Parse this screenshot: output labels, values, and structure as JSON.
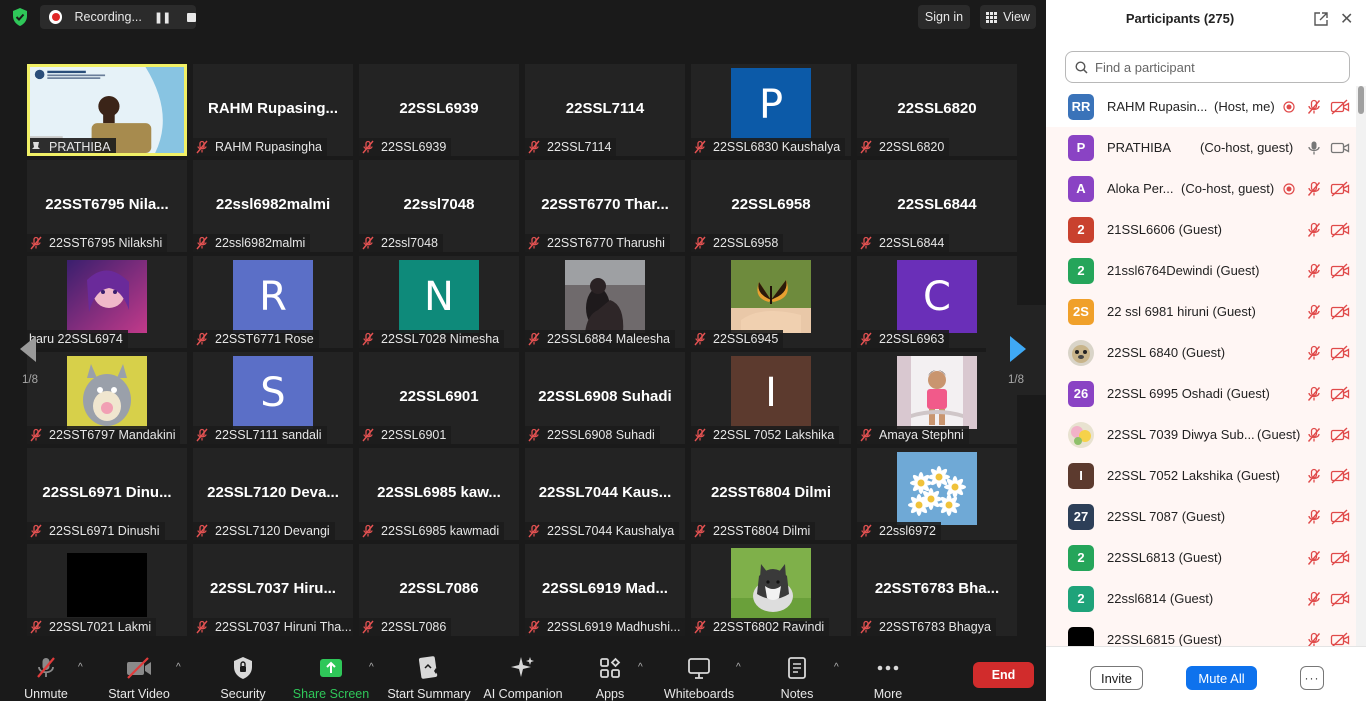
{
  "top_bar": {
    "recording_label": "Recording...",
    "sign_in": "Sign in",
    "view": "View"
  },
  "grid": {
    "page_left": "1/8",
    "page_right": "1/8",
    "tiles": [
      {
        "kind": "speaker",
        "label": "PRATHIBA"
      },
      {
        "kind": "name",
        "name": "RAHM Rupasing...",
        "label": "RAHM Rupasingha"
      },
      {
        "kind": "name",
        "name": "22SSL6939",
        "label": "22SSL6939"
      },
      {
        "kind": "name",
        "name": "22SSL7114",
        "label": "22SSL7114"
      },
      {
        "kind": "letter",
        "letter": "P",
        "color": "#0c5aa8",
        "label": "22SSL6830 Kaushalya"
      },
      {
        "kind": "name",
        "name": "22SSL6820",
        "label": "22SSL6820"
      },
      {
        "kind": "name",
        "name": "22SST6795 Nila...",
        "label": "22SST6795 Nilakshi"
      },
      {
        "kind": "name",
        "name": "22ssl6982malmi",
        "label": "22ssl6982malmi"
      },
      {
        "kind": "name",
        "name": "22ssl7048",
        "label": "22ssl7048"
      },
      {
        "kind": "name",
        "name": "22SST6770 Thar...",
        "label": "22SST6770 Tharushi"
      },
      {
        "kind": "name",
        "name": "22SSL6958",
        "label": "22SSL6958"
      },
      {
        "kind": "name",
        "name": "22SSL6844",
        "label": "22SSL6844"
      },
      {
        "kind": "photo",
        "photo": "anime",
        "label": "haru 22SSL6974",
        "nomic": true
      },
      {
        "kind": "letter",
        "letter": "R",
        "color": "#5b6fc7",
        "label": "22SST6771 Rose"
      },
      {
        "kind": "letter",
        "letter": "N",
        "color": "#0e8a7a",
        "label": "22SSL7028 Nimesha"
      },
      {
        "kind": "photo",
        "photo": "girl",
        "label": "22SSL6884 Maleesha"
      },
      {
        "kind": "photo",
        "photo": "butterfly",
        "label": "22SSL6945"
      },
      {
        "kind": "letter",
        "letter": "C",
        "color": "#6a2fb8",
        "label": "22SSL6963"
      },
      {
        "kind": "photo",
        "photo": "totoro",
        "label": "22SST6797 Mandakini"
      },
      {
        "kind": "letter",
        "letter": "S",
        "color": "#5b6fc7",
        "label": "22SSL7111 sandali"
      },
      {
        "kind": "name",
        "name": "22SSL6901",
        "label": "22SSL6901"
      },
      {
        "kind": "name",
        "name": "22SSL6908 Suhadi",
        "label": "22SSL6908 Suhadi"
      },
      {
        "kind": "letter",
        "letter": "I",
        "color": "#5c3a2e",
        "label": "22SSL 7052 Lakshika"
      },
      {
        "kind": "photo",
        "photo": "child",
        "label": "Amaya Stephni"
      },
      {
        "kind": "name",
        "name": "22SSL6971 Dinu...",
        "label": "22SSL6971 Dinushi"
      },
      {
        "kind": "name",
        "name": "22SSL7120 Deva...",
        "label": "22SSL7120 Devangi"
      },
      {
        "kind": "name",
        "name": "22SSL6985 kaw...",
        "label": "22SSL6985 kawmadi"
      },
      {
        "kind": "name",
        "name": "22SSL7044 Kaus...",
        "label": "22SSL7044 Kaushalya"
      },
      {
        "kind": "name",
        "name": "22SST6804 Dilmi",
        "label": "22SST6804 Dilmi"
      },
      {
        "kind": "photo",
        "photo": "flowers",
        "label": "22ssl6972"
      },
      {
        "kind": "photo",
        "photo": "black",
        "label": "22SSL7021 Lakmi"
      },
      {
        "kind": "name",
        "name": "22SSL7037 Hiru...",
        "label": "22SSL7037 Hiruni Tha..."
      },
      {
        "kind": "name",
        "name": "22SSL7086",
        "label": "22SSL7086"
      },
      {
        "kind": "name",
        "name": "22SSL6919 Mad...",
        "label": "22SSL6919 Madhushi..."
      },
      {
        "kind": "photo",
        "photo": "husky",
        "label": "22SST6802 Ravindi"
      },
      {
        "kind": "name",
        "name": "22SST6783 Bha...",
        "label": "22SST6783 Bhagya"
      }
    ]
  },
  "toolbar": {
    "items": [
      {
        "id": "unmute",
        "label": "Unmute",
        "icon": "mic-off-icon"
      },
      {
        "id": "start-video",
        "label": "Start Video",
        "icon": "video-off-icon"
      },
      {
        "id": "security",
        "label": "Security",
        "icon": "shield-icon"
      },
      {
        "id": "share-screen",
        "label": "Share Screen",
        "icon": "share-screen-icon"
      },
      {
        "id": "start-summary",
        "label": "Start Summary",
        "icon": "summary-icon"
      },
      {
        "id": "ai-companion",
        "label": "AI Companion",
        "icon": "sparkle-icon"
      },
      {
        "id": "apps",
        "label": "Apps",
        "icon": "apps-icon"
      },
      {
        "id": "whiteboards",
        "label": "Whiteboards",
        "icon": "whiteboard-icon"
      },
      {
        "id": "notes",
        "label": "Notes",
        "icon": "notes-icon"
      },
      {
        "id": "more",
        "label": "More",
        "icon": "more-icon"
      }
    ],
    "end": "End"
  },
  "participants": {
    "title": "Participants (275)",
    "search_placeholder": "Find a participant",
    "rows": [
      {
        "avatar": "RR",
        "color": "#3a73b9",
        "name": "RAHM Rupasin...",
        "role": "(Host, me)",
        "rec": true,
        "mic": "off",
        "video": "off"
      },
      {
        "avatar": "P",
        "color": "#8a43c4",
        "name": "PRATHIBA",
        "role": "(Co-host, guest)",
        "rec": false,
        "mic": "on",
        "video": "on"
      },
      {
        "avatar": "A",
        "color": "#8a43c4",
        "name": "Aloka Per...",
        "role": "(Co-host, guest)",
        "rec": true,
        "mic": "off",
        "video": "off"
      },
      {
        "avatar": "2",
        "color": "#c9412e",
        "name": "21SSL6606 (Guest)",
        "role": "",
        "rec": false,
        "mic": "off",
        "video": "off"
      },
      {
        "avatar": "2",
        "color": "#25a55a",
        "name": "21ssl6764Dewindi (Guest)",
        "role": "",
        "rec": false,
        "mic": "off",
        "video": "off"
      },
      {
        "avatar": "2S",
        "color": "#f0a02a",
        "name": "22 ssl 6981 hiruni (Guest)",
        "role": "",
        "rec": false,
        "mic": "off",
        "video": "off"
      },
      {
        "avatar": "img-dog",
        "color": "#d9d4c8",
        "name": "22SSL 6840 (Guest)",
        "role": "",
        "rec": false,
        "mic": "off",
        "video": "off"
      },
      {
        "avatar": "26",
        "color": "#8a43c4",
        "name": "22SSL 6995 Oshadi (Guest)",
        "role": "",
        "rec": false,
        "mic": "off",
        "video": "off"
      },
      {
        "avatar": "img-flower",
        "color": "#e8e2d0",
        "name": "22SSL 7039 Diwya Sub...",
        "role": "(Guest)",
        "rec": false,
        "mic": "off",
        "video": "off"
      },
      {
        "avatar": "I",
        "color": "#5c3a2e",
        "name": "22SSL 7052 Lakshika (Guest)",
        "role": "",
        "rec": false,
        "mic": "off",
        "video": "off"
      },
      {
        "avatar": "27",
        "color": "#2d3f58",
        "name": "22SSL 7087 (Guest)",
        "role": "",
        "rec": false,
        "mic": "off",
        "video": "off"
      },
      {
        "avatar": "2",
        "color": "#25a55a",
        "name": "22SSL6813 (Guest)",
        "role": "",
        "rec": false,
        "mic": "off",
        "video": "off"
      },
      {
        "avatar": "2",
        "color": "#1fa37a",
        "name": "22ssl6814 (Guest)",
        "role": "",
        "rec": false,
        "mic": "off",
        "video": "off"
      },
      {
        "avatar": "",
        "color": "#000000",
        "name": "22SSL6815 (Guest)",
        "role": "",
        "rec": false,
        "mic": "off",
        "video": "off"
      }
    ],
    "invite": "Invite",
    "mute_all": "Mute All",
    "more": "···"
  }
}
